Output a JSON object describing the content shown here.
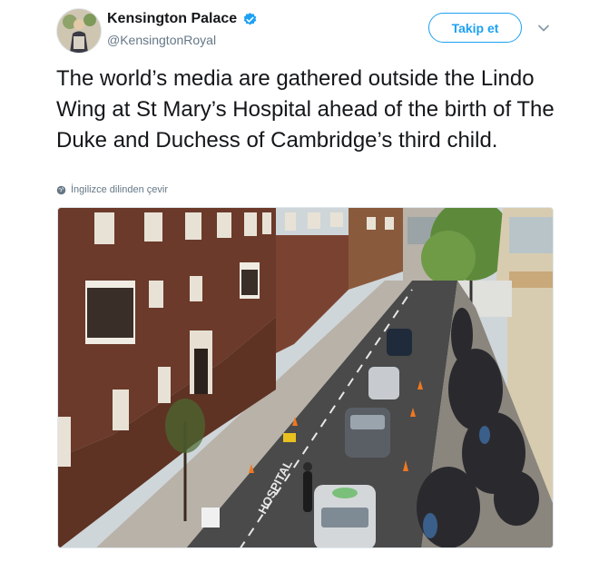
{
  "account": {
    "display_name": "Kensington Palace",
    "handle": "@KensingtonRoyal",
    "verified": true,
    "avatar_icon": "profile-photo"
  },
  "actions": {
    "follow_label": "Takip et",
    "menu_icon": "chevron-down-icon"
  },
  "tweet": {
    "text": "The world’s media are gathered outside the Lindo Wing at St Mary’s Hospital ahead of the birth of The Duke and Duchess of Cambridge’s third child.",
    "translate_label": "İngilizce dilinden çevir",
    "translate_icon": "globe-icon"
  },
  "photo": {
    "description_icon": "street-photo",
    "road_marking": "HOSPITAL",
    "colors": {
      "brick": "#6b3a2a",
      "road": "#4a4a4a",
      "sky": "#cfd6d9",
      "tree": "#5d8a3a"
    }
  },
  "theme": {
    "accent": "#1da1f2",
    "text": "#14171a",
    "muted": "#657786"
  }
}
